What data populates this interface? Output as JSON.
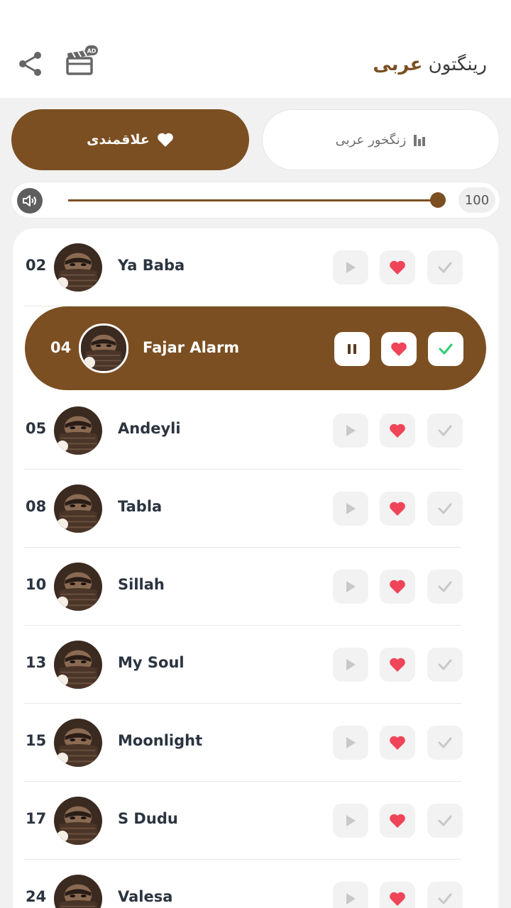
{
  "header": {
    "title_part1": "عربی",
    "title_part2": "رینگتون",
    "ad_badge": "AD"
  },
  "tabs": {
    "favorites_label": "علاقمندی",
    "arabic_ringtones_label": "زنگخور عربی"
  },
  "volume": {
    "value": "100",
    "level": 1.0
  },
  "songs": [
    {
      "number": "02",
      "title": "Ya Baba",
      "active": false
    },
    {
      "number": "04",
      "title": "Fajar Alarm",
      "active": true
    },
    {
      "number": "05",
      "title": "Andeyli",
      "active": false
    },
    {
      "number": "08",
      "title": "Tabla",
      "active": false
    },
    {
      "number": "10",
      "title": "Sillah",
      "active": false
    },
    {
      "number": "13",
      "title": "My Soul",
      "active": false
    },
    {
      "number": "15",
      "title": "Moonlight",
      "active": false
    },
    {
      "number": "17",
      "title": "S Dudu",
      "active": false
    },
    {
      "number": "24",
      "title": "Valesa",
      "active": false
    }
  ],
  "colors": {
    "brand": "#7b4f22",
    "heart": "#f04458",
    "check_active": "#2ecc71",
    "text_dark": "#2b3440"
  },
  "icons": {
    "share": "share-icon",
    "ad": "ad-clapperboard-icon",
    "favorites": "heart-icon",
    "arabic": "equalizer-icon",
    "volume": "speaker-icon",
    "play": "play-icon",
    "pause": "pause-icon",
    "fav": "heart-icon",
    "set": "check-icon"
  }
}
